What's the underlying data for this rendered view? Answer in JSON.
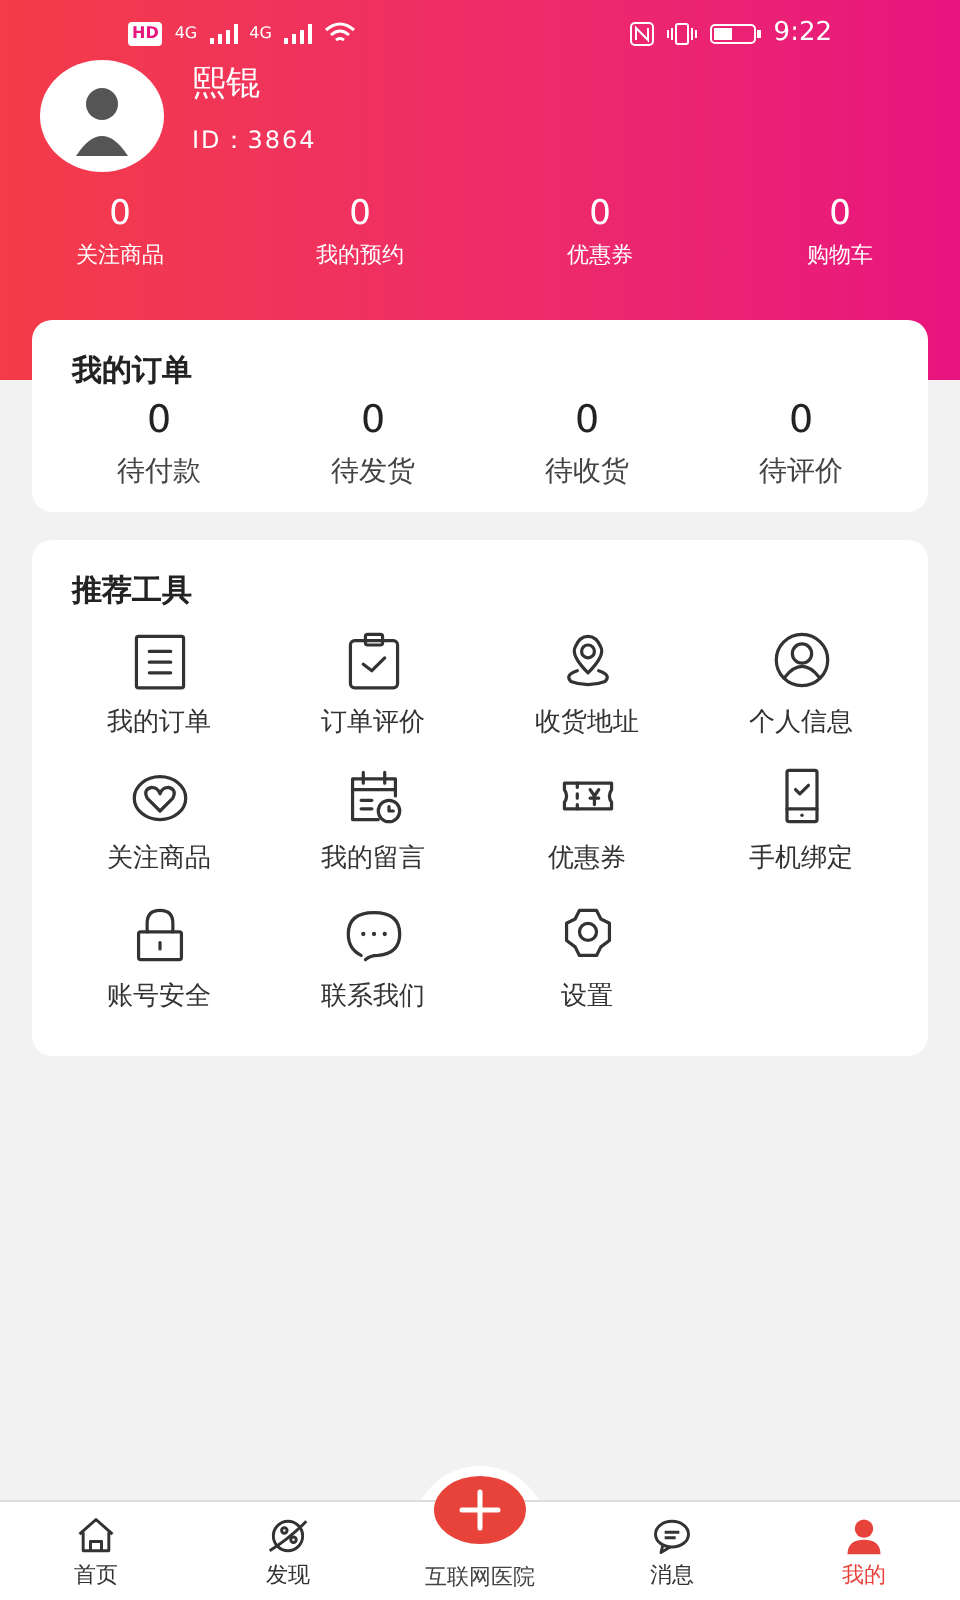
{
  "status_bar": {
    "hd": "HD",
    "network_1": "4G",
    "network_2": "4G",
    "time": "9:22"
  },
  "profile": {
    "name": "熙锟",
    "id": "ID：3864"
  },
  "stats": [
    {
      "value": "0",
      "label": "关注商品"
    },
    {
      "value": "0",
      "label": "我的预约"
    },
    {
      "value": "0",
      "label": "优惠券"
    },
    {
      "value": "0",
      "label": "购物车"
    }
  ],
  "orders": {
    "title": "我的订单",
    "items": [
      {
        "value": "0",
        "label": "待付款"
      },
      {
        "value": "0",
        "label": "待发货"
      },
      {
        "value": "0",
        "label": "待收货"
      },
      {
        "value": "0",
        "label": "待评价"
      }
    ]
  },
  "tools": {
    "title": "推荐工具",
    "items": [
      {
        "label": "我的订单"
      },
      {
        "label": "订单评价"
      },
      {
        "label": "收货地址"
      },
      {
        "label": "个人信息"
      },
      {
        "label": "关注商品"
      },
      {
        "label": "我的留言"
      },
      {
        "label": "优惠券"
      },
      {
        "label": "手机绑定"
      },
      {
        "label": "账号安全"
      },
      {
        "label": "联系我们"
      },
      {
        "label": "设置"
      }
    ]
  },
  "tab_bar": [
    {
      "label": "首页",
      "selected": false,
      "kind": "tab"
    },
    {
      "label": "发现",
      "selected": false,
      "kind": "tab"
    },
    {
      "label": "互联网医院",
      "selected": false,
      "kind": "center"
    },
    {
      "label": "消息",
      "selected": false,
      "kind": "tab"
    },
    {
      "label": "我的",
      "selected": true,
      "kind": "tab"
    }
  ]
}
